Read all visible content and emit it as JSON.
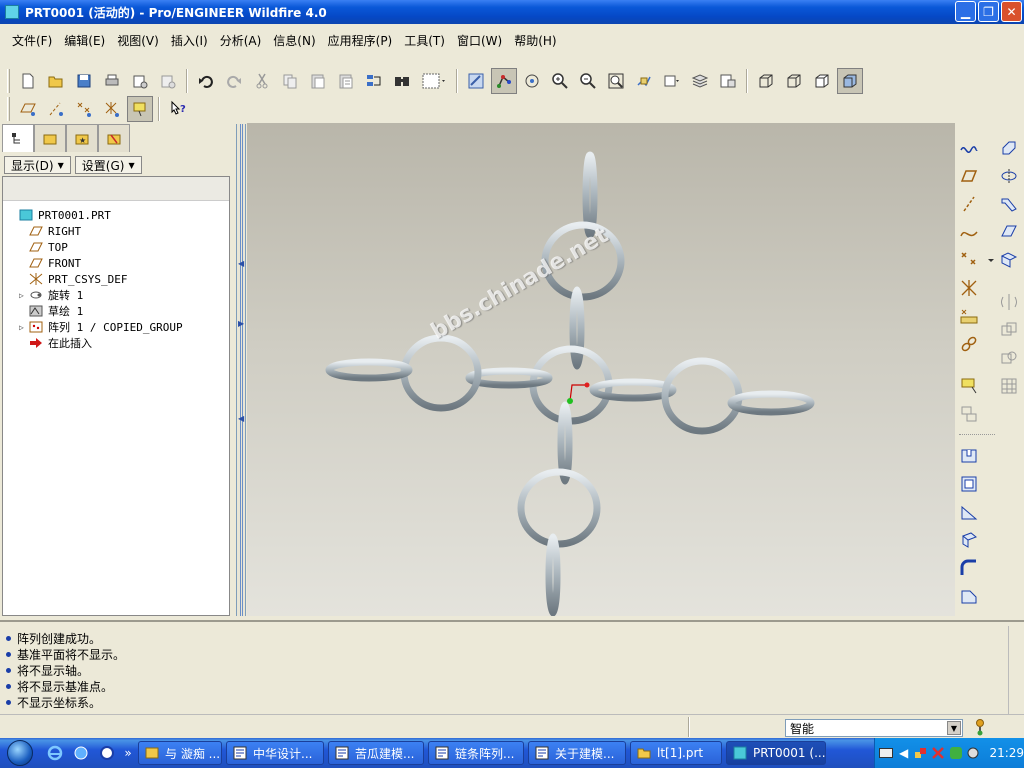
{
  "window": {
    "title": "PRT0001 (活动的) - Pro/ENGINEER Wildfire 4.0",
    "minimize": "▁",
    "restore": "❐",
    "close": "✕"
  },
  "menu": [
    "文件(F)",
    "编辑(E)",
    "视图(V)",
    "插入(I)",
    "分析(A)",
    "信息(N)",
    "应用程序(P)",
    "工具(T)",
    "窗口(W)",
    "帮助(H)"
  ],
  "toolbar_row1": [
    "new-icon",
    "open-icon",
    "save-icon",
    "print-icon",
    "send-mail-icon",
    "send-link-icon",
    "undo-icon",
    "redo-icon",
    "cut-icon",
    "copy-icon",
    "paste-icon",
    "paste-special-icon",
    "regenerate-icon",
    "find-icon",
    "selection-filter-icon",
    "repaint-icon",
    "spin-center-icon",
    "orient-mode-icon",
    "zoom-in-icon",
    "zoom-out-icon",
    "refit-icon",
    "reorient-icon",
    "saved-views-icon",
    "layers-icon",
    "view-manager-icon",
    "wireframe-icon",
    "hidden-line-icon",
    "no-hidden-icon",
    "shading-icon"
  ],
  "toolbar_row2": [
    "datum-plane-display-icon",
    "datum-axis-display-icon",
    "datum-point-display-icon",
    "csys-display-icon",
    "annotation-display-icon",
    "context-help-icon"
  ],
  "left_panel": {
    "tabs": [
      "model-tree-tab",
      "folder-browser-tab",
      "favorites-tab",
      "connections-tab"
    ],
    "show_button": "显示(D)",
    "settings_button": "设置(G)",
    "tree": [
      {
        "label": "PRT0001.PRT",
        "icon": "part-icon",
        "indent": 0,
        "expandable": false
      },
      {
        "label": "RIGHT",
        "icon": "datum-plane-icon",
        "indent": 1,
        "expandable": false
      },
      {
        "label": "TOP",
        "icon": "datum-plane-icon",
        "indent": 1,
        "expandable": false
      },
      {
        "label": "FRONT",
        "icon": "datum-plane-icon",
        "indent": 1,
        "expandable": false
      },
      {
        "label": "PRT_CSYS_DEF",
        "icon": "csys-icon",
        "indent": 1,
        "expandable": false
      },
      {
        "label": "旋转 1",
        "icon": "revolve-icon",
        "indent": 1,
        "expandable": true
      },
      {
        "label": "草绘 1",
        "icon": "sketch-icon",
        "indent": 1,
        "expandable": false
      },
      {
        "label": "阵列 1 / COPIED_GROUP",
        "icon": "pattern-icon",
        "indent": 1,
        "expandable": true
      },
      {
        "label": "在此插入",
        "icon": "insert-here-icon",
        "indent": 1,
        "expandable": false
      }
    ]
  },
  "graphics": {
    "watermark": "bbs.chinade.net"
  },
  "messages": [
    "阵列创建成功。",
    "基准平面将不显示。",
    "将不显示轴。",
    "将不显示基准点。",
    "不显示坐标系。"
  ],
  "status": {
    "filter_value": "智能"
  },
  "taskbar": {
    "tasks": [
      {
        "label": "与 漩痴 ...",
        "icon": "chat-icon"
      },
      {
        "label": "中华设计...",
        "icon": "browser-icon"
      },
      {
        "label": "苦瓜建模...",
        "icon": "browser-icon"
      },
      {
        "label": "链条阵列...",
        "icon": "browser-icon"
      },
      {
        "label": "关于建模...",
        "icon": "browser-icon"
      },
      {
        "label": "lt[1].prt",
        "icon": "folder-icon"
      },
      {
        "label": "PRT0001 (...",
        "icon": "proe-icon"
      }
    ],
    "clock": "21:29"
  },
  "colors": {
    "title_bar": "#0a58d8",
    "taskbar": "#2157d7",
    "link_color": "#b7c1c8"
  }
}
